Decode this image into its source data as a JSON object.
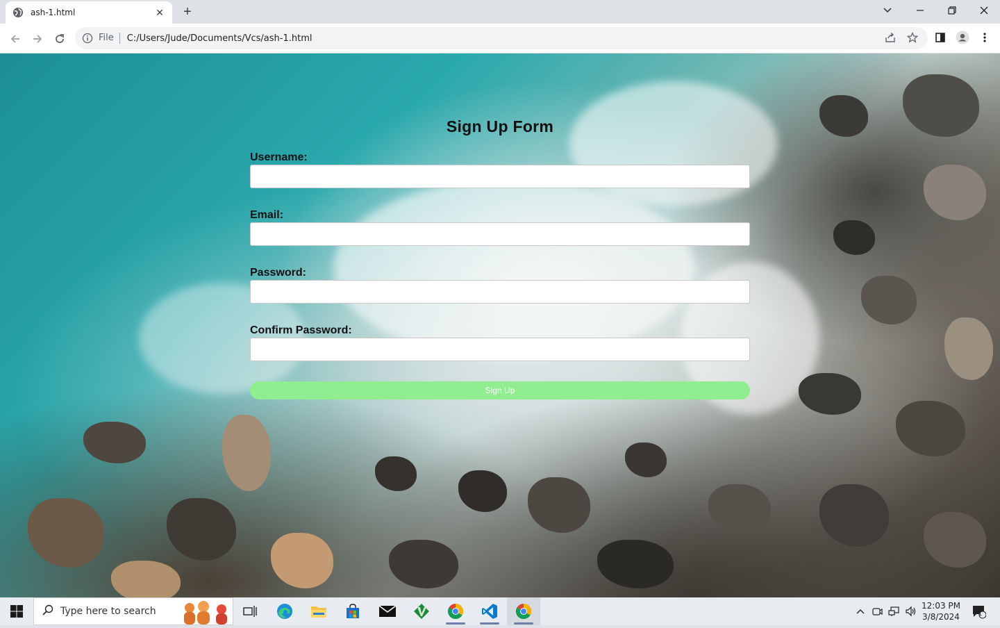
{
  "browser": {
    "tab_title": "ash-1.html",
    "new_tab_symbol": "+",
    "close_tab_symbol": "✕",
    "omnibox": {
      "scheme_label": "File",
      "url": "C:/Users/Jude/Documents/Vcs/ash-1.html"
    }
  },
  "form": {
    "title": "Sign Up Form",
    "fields": [
      {
        "label": "Username:",
        "value": ""
      },
      {
        "label": "Email:",
        "value": ""
      },
      {
        "label": "Password:",
        "value": ""
      },
      {
        "label": "Confirm Password:",
        "value": ""
      }
    ],
    "submit_label": "Sign Up",
    "submit_color": "#90ee90"
  },
  "taskbar": {
    "search_placeholder": "Type here to search",
    "time": "12:03 PM",
    "date": "3/8/2024",
    "notification_count": "1",
    "apps": [
      "task-view-icon",
      "edge-icon",
      "file-explorer-icon",
      "store-icon",
      "mail-icon",
      "vim-icon",
      "chrome-icon",
      "vscode-icon",
      "chrome-icon"
    ]
  }
}
